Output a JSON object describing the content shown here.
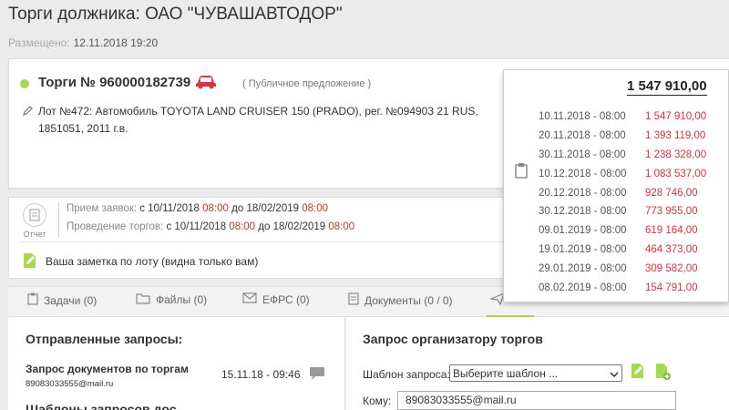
{
  "page": {
    "title": "Торги должника: ОАО \"ЧУВАШАВТОДОР\"",
    "posted_label": "Размещено:",
    "posted_date": "12.11.2018 19:20"
  },
  "lot": {
    "title": "Торги № 960000182739",
    "type": "( Публичное предложение )",
    "description": "Лот №472: Автомобиль TOYOTA LAND CRUISER 150 (PRADO), рег. №094903 21 RUS, 1851051, 2011 г.в.",
    "status_color": "#a8d84e"
  },
  "dates": {
    "report_label": "Отчет",
    "accept": {
      "label": "Прием заявок:",
      "from_word": "с",
      "from_date": "10/11/2018",
      "from_time": "08:00",
      "to_word": "до",
      "to_date": "18/02/2019",
      "to_time": "08:00"
    },
    "trading": {
      "label": "Проведение торгов:",
      "from_word": "с",
      "from_date": "10/11/2018",
      "from_time": "08:00",
      "to_word": "до",
      "to_date": "18/02/2019",
      "to_time": "08:00"
    }
  },
  "note": {
    "text": "Ваша заметка по лоту (видна только вам)"
  },
  "tabs": [
    {
      "label": "Задачи (0)",
      "icon": "clipboard-icon"
    },
    {
      "label": "Файлы (0)",
      "icon": "folder-icon"
    },
    {
      "label": "ЕФРС (0)",
      "icon": "envelope-icon"
    },
    {
      "label": "Документы (0 / 0)",
      "icon": "document-icon"
    }
  ],
  "left_panel": {
    "title": "Отправленные запросы:",
    "request_name": "Запрос документов по торгам",
    "request_email": "89083033555@mail.ru",
    "request_date": "15.11.18 - 09:46",
    "templates_title": "Шаблоны запросов дос..."
  },
  "right_panel": {
    "title": "Запрос организатору торгов",
    "template_label": "Шаблон запроса:",
    "template_select": "Выберите шаблон ...",
    "to_label": "Кому:",
    "to_value": "89083033555@mail.ru"
  },
  "price_schedule": {
    "total": "1 547 910,00",
    "rows": [
      {
        "date": "10.11.2018 - 08:00",
        "price": "1 547 910,00"
      },
      {
        "date": "20.11.2018 - 08:00",
        "price": "1 393 119,00"
      },
      {
        "date": "30.11.2018 - 08:00",
        "price": "1 238 328,00"
      },
      {
        "date": "10.12.2018 - 08:00",
        "price": "1 083 537,00"
      },
      {
        "date": "20.12.2018 - 08:00",
        "price": "928 746,00"
      },
      {
        "date": "30.12.2018 - 08:00",
        "price": "773 955,00"
      },
      {
        "date": "09.01.2019 - 08:00",
        "price": "619 164,00"
      },
      {
        "date": "19.01.2019 - 08:00",
        "price": "464 373,00"
      },
      {
        "date": "29.01.2019 - 08:00",
        "price": "309 582,00"
      },
      {
        "date": "08.02.2019 - 08:00",
        "price": "154 791,00"
      }
    ]
  },
  "colors": {
    "accent": "#a8d84e",
    "price": "#d9333f",
    "time": "#c0392b"
  }
}
